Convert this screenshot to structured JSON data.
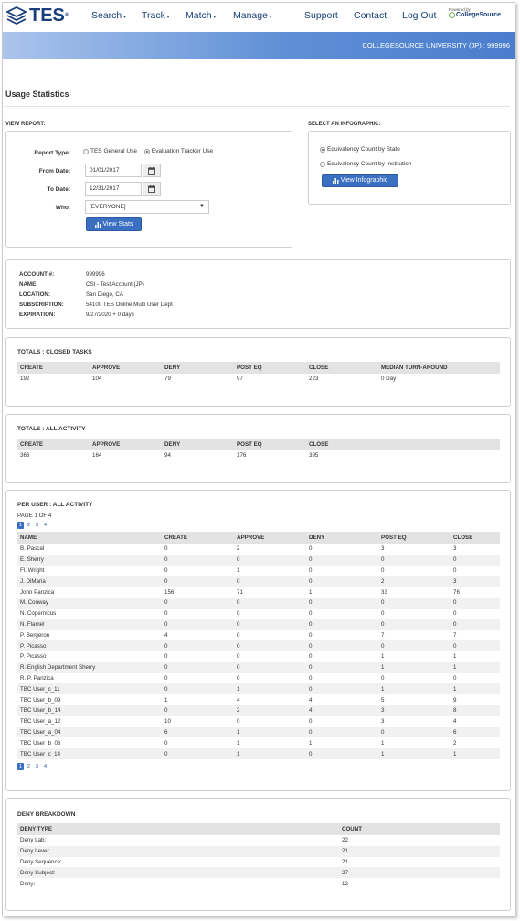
{
  "nav": {
    "logo_text": "TES",
    "logo_reg": "®",
    "items": [
      "Search",
      "Track",
      "Match",
      "Manage"
    ],
    "right_items": [
      "Support",
      "Contact",
      "Log Out"
    ],
    "powered_by": "Powered by",
    "brand": "CollegeSource"
  },
  "banner": {
    "institution": "COLLEGESOURCE UNIVERSITY (JP) : 999996"
  },
  "page": {
    "title": "Usage Statistics"
  },
  "view_report": {
    "label": "VIEW REPORT:",
    "report_type_label": "Report Type:",
    "report_type_options": [
      "TES General Use",
      "Evaluation Tracker Use"
    ],
    "report_type_selected": "Evaluation Tracker Use",
    "from_date_label": "From Date:",
    "from_date": "01/01/2017",
    "to_date_label": "To Date:",
    "to_date": "12/31/2017",
    "who_label": "Who:",
    "who_value": "[EVERYONE]",
    "view_stats_button": "View Stats"
  },
  "infographic": {
    "label": "SELECT AN INFOGRAPHIC:",
    "options": [
      "Equivalency Count by State",
      "Equivalency Count by Institution"
    ],
    "selected": "Equivalency Count by State",
    "button": "View Infographic"
  },
  "account": {
    "rows": [
      {
        "k": "ACCOUNT #:",
        "v": "999996"
      },
      {
        "k": "NAME:",
        "v": "CSI - Test Account (JP)"
      },
      {
        "k": "LOCATION:",
        "v": "San Diego, CA"
      },
      {
        "k": "SUBSCRIPTION:",
        "v": "54100 TES Online Multi User Dept"
      },
      {
        "k": "EXPIRATION:",
        "v": "9/27/2020 + 0 days"
      }
    ]
  },
  "closed_tasks": {
    "title": "TOTALS : CLOSED TASKS",
    "headers": [
      "CREATE",
      "APPROVE",
      "DENY",
      "POST EQ",
      "CLOSE",
      "MEDIAN TURN-AROUND"
    ],
    "row": [
      "192",
      "104",
      "79",
      "97",
      "223",
      "0 Day"
    ]
  },
  "all_activity": {
    "title": "TOTALS : ALL ACTIVITY",
    "headers": [
      "CREATE",
      "APPROVE",
      "DENY",
      "POST EQ",
      "CLOSE",
      ""
    ],
    "row": [
      "366",
      "164",
      "94",
      "176",
      "395",
      ""
    ]
  },
  "per_user": {
    "title": "PER USER : ALL ACTIVITY",
    "page_label": "PAGE 1 OF 4",
    "pages": [
      "1",
      "2",
      "3",
      "4"
    ],
    "current_page": "1",
    "headers": [
      "NAME",
      "CREATE",
      "APPROVE",
      "DENY",
      "POST EQ",
      "CLOSE"
    ],
    "rows": [
      [
        "B. Pascal",
        "0",
        "2",
        "0",
        "3",
        "3"
      ],
      [
        "E. Sherry",
        "0",
        "0",
        "0",
        "0",
        "0"
      ],
      [
        "Fl. Wright",
        "0",
        "1",
        "0",
        "0",
        "0"
      ],
      [
        "J. DiMaria",
        "0",
        "0",
        "0",
        "2",
        "3"
      ],
      [
        "John Panzica",
        "156",
        "71",
        "1",
        "33",
        "76"
      ],
      [
        "M. Conway",
        "0",
        "0",
        "0",
        "0",
        "0"
      ],
      [
        "N. Copernicus",
        "0",
        "0",
        "0",
        "0",
        "0"
      ],
      [
        "N. Flamel",
        "0",
        "0",
        "0",
        "0",
        "0"
      ],
      [
        "P. Bergeron",
        "4",
        "0",
        "0",
        "7",
        "7"
      ],
      [
        "P. Picasso",
        "0",
        "0",
        "0",
        "0",
        "0"
      ],
      [
        "P. Picasso",
        "0",
        "0",
        "0",
        "1",
        "1"
      ],
      [
        "R. English Department Sherry",
        "0",
        "0",
        "0",
        "1",
        "1"
      ],
      [
        "R. P. Panzica",
        "0",
        "0",
        "0",
        "0",
        "0"
      ],
      [
        "TBC User_c_11",
        "0",
        "1",
        "0",
        "1",
        "1"
      ],
      [
        "TBC User_b_09",
        "1",
        "4",
        "4",
        "5",
        "9"
      ],
      [
        "TBC User_b_14",
        "0",
        "2",
        "4",
        "3",
        "8"
      ],
      [
        "TBC User_a_12",
        "10",
        "0",
        "0",
        "3",
        "4"
      ],
      [
        "TBC User_a_04",
        "6",
        "1",
        "0",
        "0",
        "6"
      ],
      [
        "TBC User_b_06",
        "0",
        "1",
        "1",
        "1",
        "2"
      ],
      [
        "TBC User_c_14",
        "0",
        "1",
        "0",
        "1",
        "1"
      ]
    ]
  },
  "deny_breakdown": {
    "title": "DENY BREAKDOWN",
    "headers": [
      "DENY TYPE",
      "COUNT"
    ],
    "rows": [
      [
        "Deny Lab:",
        "22"
      ],
      [
        "Deny Level:",
        "21"
      ],
      [
        "Deny Sequence:",
        "21"
      ],
      [
        "Deny Subject:",
        "27"
      ],
      [
        "Deny:",
        "12"
      ]
    ]
  }
}
